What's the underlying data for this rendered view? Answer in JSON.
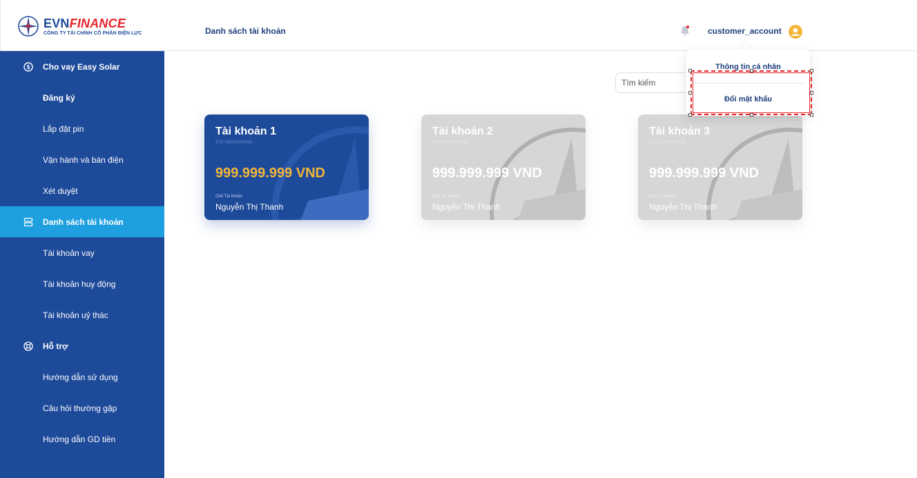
{
  "header": {
    "logo_brand_evn": "EVN",
    "logo_brand_finance": "FINANCE",
    "logo_sub": "CÔNG TY TÀI CHÍNH CỔ PHẦN ĐIỆN LỰC",
    "page_title": "Danh sách tài khoản",
    "user_name": "customer_account"
  },
  "sidebar": {
    "items": [
      {
        "label": "Cho vay Easy Solar"
      },
      {
        "label": "Đăng ký"
      },
      {
        "label": "Lắp đặt pin"
      },
      {
        "label": "Vận hành và bán điện"
      },
      {
        "label": "Xét duyệt"
      },
      {
        "label": "Danh sách tài khoản"
      },
      {
        "label": "Tài khoản vay"
      },
      {
        "label": "Tài khoản huy động"
      },
      {
        "label": "Tài khoản uỷ thác"
      },
      {
        "label": "Hỗ trợ"
      },
      {
        "label": "Hướng dẫn sử dụng"
      },
      {
        "label": "Câu hỏi thường gặp"
      },
      {
        "label": "Hướng dẫn GD tiền"
      }
    ]
  },
  "search": {
    "placeholder": "Tìm kiếm"
  },
  "cards": [
    {
      "title": "Tài khoản  1",
      "stk": "STK 000000000000",
      "amount": "999.999.999 VND",
      "owner_label": "Chủ Tài khoản",
      "owner": "Nguyễn Thị Thanh"
    },
    {
      "title": "Tài khoản  2",
      "stk": "STK 000000000000",
      "amount": "999.999.999 VND",
      "owner_label": "Chủ Tài khoản",
      "owner": "Nguyễn Thị Thanh"
    },
    {
      "title": "Tài khoản 3",
      "stk": "STK 000000000000",
      "amount": "999.999.999 VND",
      "owner_label": "Chủ Tài khoản",
      "owner": "Nguyễn Thị Thanh"
    }
  ],
  "dropdown": {
    "profile": "Thông tin cá nhân",
    "change_password": "Đổi mật khẩu"
  },
  "colors": {
    "primary": "#1e4a9a",
    "active_nav": "#1ea0e0",
    "accent": "#f3b63a",
    "brand_red": "#e3262b"
  }
}
